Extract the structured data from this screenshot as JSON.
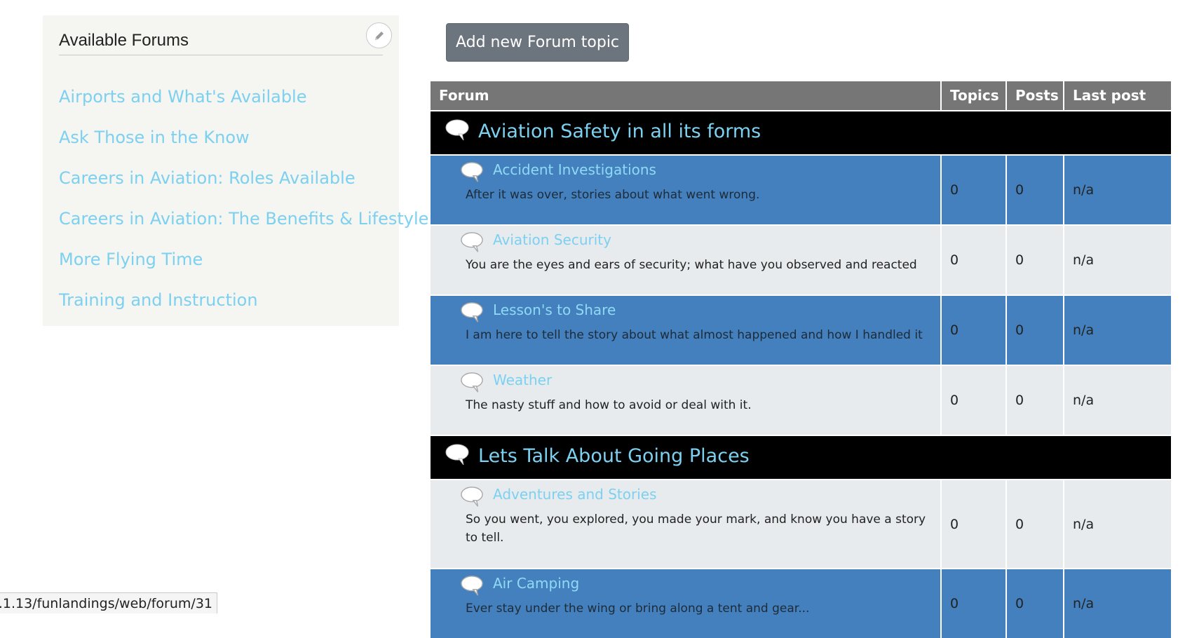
{
  "sidebar": {
    "title": "Available Forums",
    "items": [
      {
        "label": "Airports and What's Available"
      },
      {
        "label": "Ask Those in the Know"
      },
      {
        "label": "Careers in Aviation: Roles Available"
      },
      {
        "label": "Careers in Aviation: The Benefits & Lifestyle"
      },
      {
        "label": "More Flying Time"
      },
      {
        "label": "Training and Instruction"
      }
    ]
  },
  "toolbar": {
    "add_label": "Add new Forum topic"
  },
  "table": {
    "headers": {
      "forum": "Forum",
      "topics": "Topics",
      "posts": "Posts",
      "last_post": "Last post"
    },
    "categories": [
      {
        "title": "Aviation Safety in all its forms",
        "forums": [
          {
            "name": "Accident Investigations",
            "description": "After it was over, stories about what went wrong.",
            "topics": "0",
            "posts": "0",
            "last_post": "n/a"
          },
          {
            "name": "Aviation Security",
            "description": "You are the eyes and ears of security; what have you observed and reacted",
            "topics": "0",
            "posts": "0",
            "last_post": "n/a"
          },
          {
            "name": "Lesson's to Share",
            "description": "I am here to tell the story about what almost happened and how I handled it",
            "topics": "0",
            "posts": "0",
            "last_post": "n/a"
          },
          {
            "name": "Weather",
            "description": "The nasty stuff and how to avoid or deal with it.",
            "topics": "0",
            "posts": "0",
            "last_post": "n/a"
          }
        ]
      },
      {
        "title": "Lets Talk About Going Places",
        "forums": [
          {
            "name": "Adventures and Stories",
            "description": "So you went, you explored, you made your mark, and know you have a story to tell.",
            "topics": "0",
            "posts": "0",
            "last_post": "n/a"
          },
          {
            "name": "Air Camping",
            "description": "Ever stay under the wing or bring along a tent and gear...",
            "topics": "0",
            "posts": "0",
            "last_post": "n/a"
          }
        ]
      }
    ]
  },
  "status_url": "3.1.13/funlandings/web/forum/31",
  "colors": {
    "link": "#7cd0f0",
    "row_blue": "#4380bd",
    "row_gray": "#e8ebee",
    "header_bg": "#767676",
    "category_bg": "#000000",
    "button_bg": "#6c757d"
  },
  "icons": {
    "edit": "pencil-icon",
    "forum": "speech-bubble-icon"
  }
}
